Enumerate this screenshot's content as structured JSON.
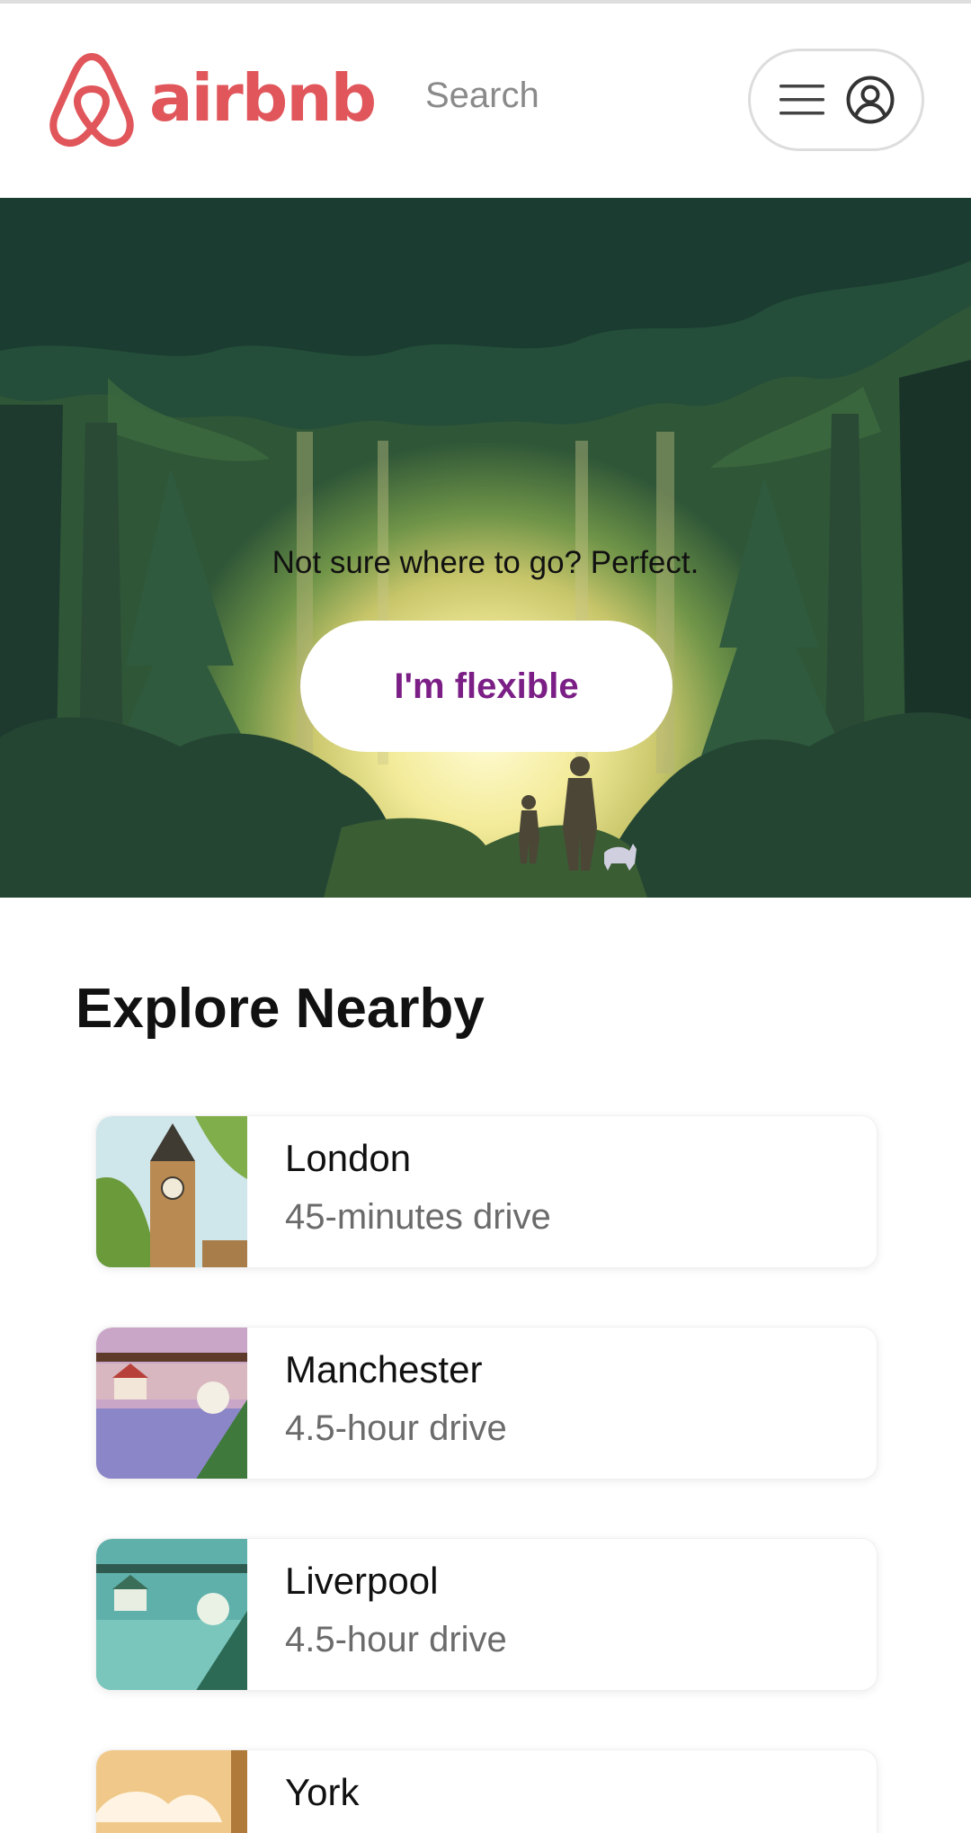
{
  "header": {
    "logo_text": "airbnb",
    "search_label": "Search"
  },
  "hero": {
    "tagline": "Not sure where to go? Perfect.",
    "button_label": "I'm flexible"
  },
  "explore": {
    "title": "Explore Nearby",
    "items": [
      {
        "name": "London",
        "distance": "45-minutes drive"
      },
      {
        "name": "Manchester",
        "distance": "4.5-hour drive"
      },
      {
        "name": "Liverpool",
        "distance": "4.5-hour drive"
      },
      {
        "name": "York",
        "distance": ""
      }
    ]
  },
  "colors": {
    "brand": "#E0565B",
    "button_text": "#7B1F86"
  },
  "icons": [
    "airbnb-logo-icon",
    "menu-icon",
    "user-account-icon"
  ]
}
